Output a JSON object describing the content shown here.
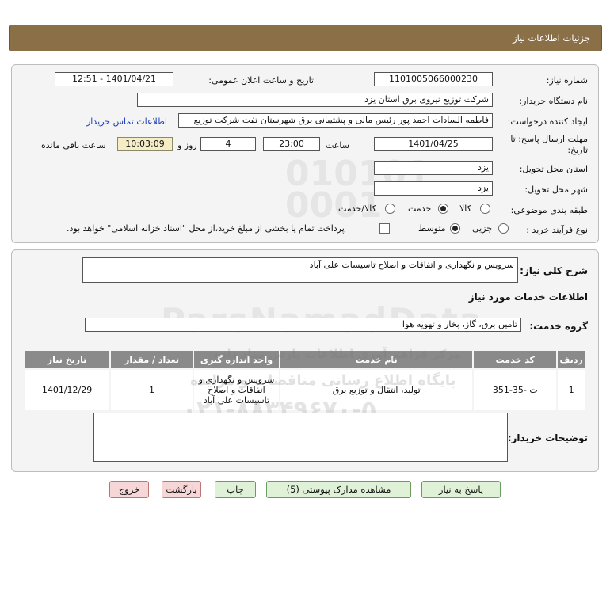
{
  "header": {
    "title": "جزئیات اطلاعات نیاز"
  },
  "form": {
    "need_number_label": "شماره نیاز:",
    "need_number": "1101005066000230",
    "announce_label": "تاریخ و ساعت اعلان عمومی:",
    "announce_value": "1401/04/21 - 12:51",
    "buyer_label": "نام دستگاه خریدار:",
    "buyer_value": "شرکت توزیع نیروی برق استان یزد",
    "creator_label": "ایجاد کننده درخواست:",
    "creator_value": "فاطمه السادات  احمد پور  رئیس مالی و پشتیبانی برق شهرستان تفت شرکت توزیع",
    "contact_link": "اطلاعات تماس خریدار",
    "deadline_label_1": "مهلت ارسال پاسخ: تا",
    "deadline_label_2": "تاریخ:",
    "deadline_date": "1401/04/25",
    "time_label": "ساعت",
    "deadline_time": "23:00",
    "days_value": "4",
    "days_label": "روز و",
    "remaining_time": "10:03:09",
    "remaining_label": "ساعت باقی مانده",
    "province_label": "استان محل تحویل:",
    "province_value": "یزد",
    "city_label": "شهر محل تحویل:",
    "city_value": "یزد",
    "category_label": "طبقه بندی موضوعی:",
    "category_options": [
      "کالا",
      "خدمت",
      "کالا/خدمت"
    ],
    "category_selected": "خدمت",
    "process_label": "نوع فرآیند خرید :",
    "process_options": [
      "جزیی",
      "متوسط"
    ],
    "process_selected": "متوسط",
    "payment_note": "پرداخت تمام یا بخشی از مبلغ خرید،از محل \"اسناد خزانه اسلامی\" خواهد بود."
  },
  "details": {
    "summary_label": "شرح کلی نیاز:",
    "summary_value": "سرویس و نگهداری و اتفاقات و اصلاح تاسیسات علی آباد",
    "services_heading": "اطلاعات خدمات مورد نیاز",
    "service_group_label": "گروه خدمت:",
    "service_group_value": "تامین برق، گاز، بخار و تهویه هوا",
    "table": {
      "headers": [
        "ردیف",
        "کد خدمت",
        "نام خدمت",
        "واحد اندازه گیری",
        "تعداد / مقدار",
        "تاریخ نیاز"
      ],
      "rows": [
        [
          "1",
          "ت -35-351",
          "تولید، انتقال و توزیع برق",
          "سرویس و نگهداری و اتفاقات و اصلاح تاسیسات علی آباد",
          "1",
          "1401/12/29"
        ]
      ]
    },
    "buyer_notes_label": "توضیحات خریدار:",
    "buyer_notes_value": ""
  },
  "buttons": {
    "reply": "پاسخ به نیاز",
    "attachments": "مشاهده مدارک پیوستی (5)",
    "print": "چاپ",
    "back": "بازگشت",
    "exit": "خروج"
  },
  "watermark": {
    "line1": "ParsNamadData",
    "line2": "مرکز فراهم آوری اطلاعات پارس نماد داده",
    "line3": "پایگاه اطلاع رسانی مناقصات و مزایده",
    "line4": "۰۲۱-۸۸۳۴۹۶۷۰-۵",
    "digits": "010101 0001"
  },
  "colors": {
    "header_bg": "#8b6f47",
    "button_green": "#dff2d8",
    "button_pink": "#f6d6d6",
    "link": "#1a3fbf",
    "table_header": "#8a8a8a"
  }
}
